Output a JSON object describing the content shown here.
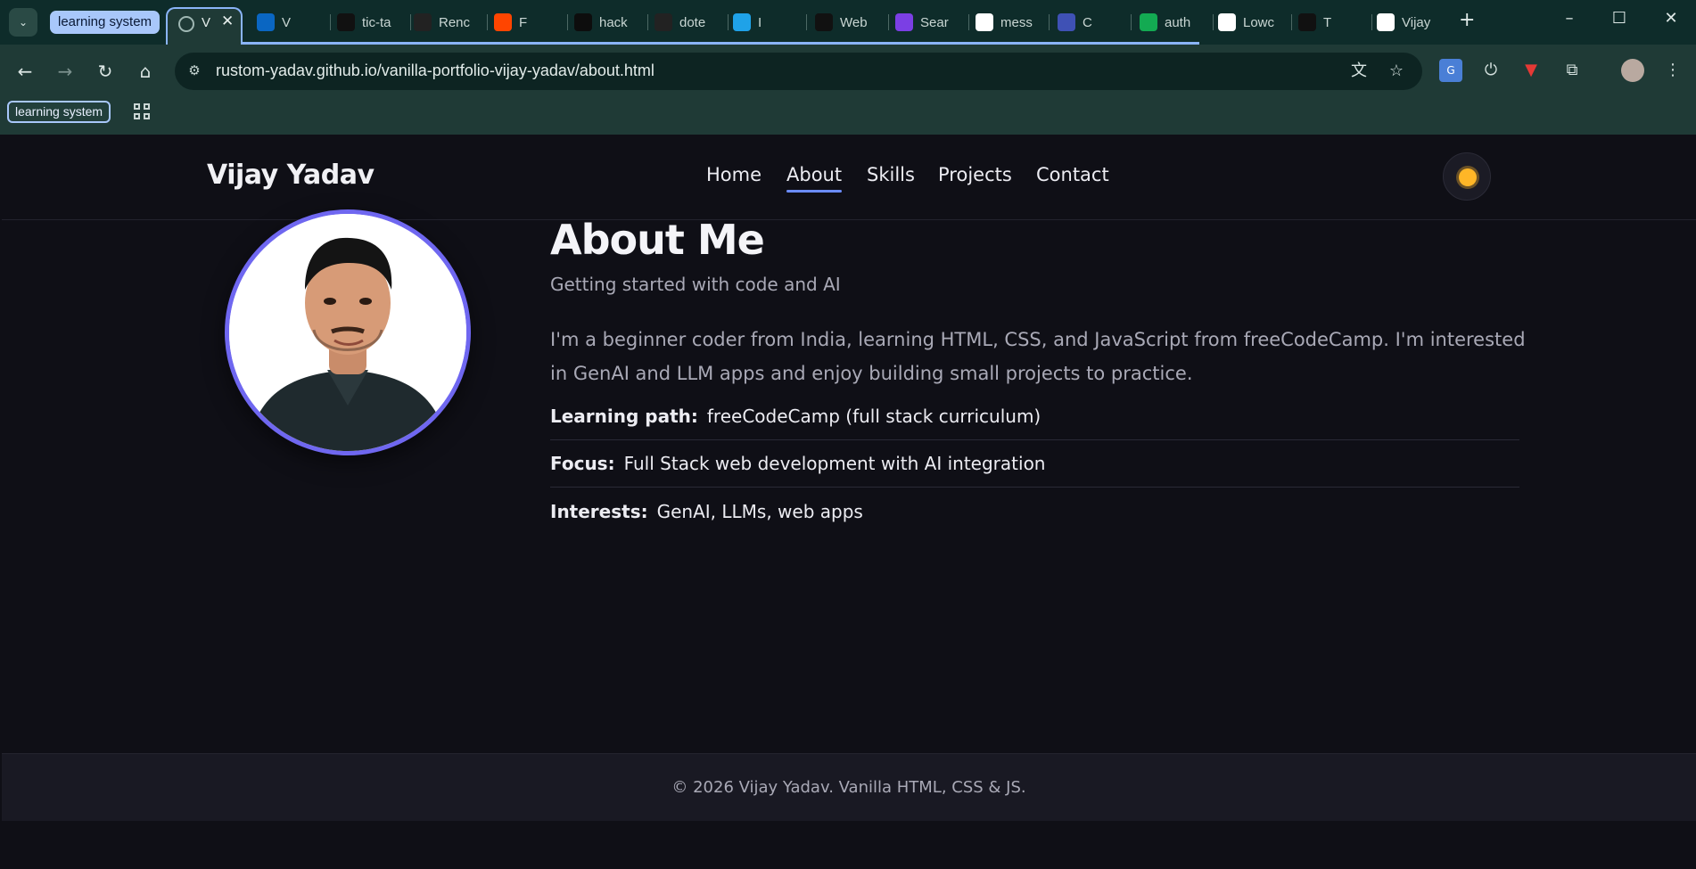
{
  "browser": {
    "tab_group_label": "learning system",
    "active_tab_title": "V",
    "tabs": [
      {
        "title": "V",
        "icon": "linkedin-icon",
        "color": "#0a66c2"
      },
      {
        "title": "tic-ta",
        "icon": "triangle-icon",
        "color": "#111111"
      },
      {
        "title": "Renc",
        "icon": "render-icon",
        "color": "#222222"
      },
      {
        "title": "F",
        "icon": "reddit-icon",
        "color": "#ff4500"
      },
      {
        "title": "hack",
        "icon": "hackernoon-icon",
        "color": "#0d0d0d"
      },
      {
        "title": "dote",
        "icon": "dotenv-icon",
        "color": "#222222"
      },
      {
        "title": "I",
        "icon": "is-icon",
        "color": "#1fa2e8"
      },
      {
        "title": "Web",
        "icon": "mk-icon",
        "color": "#111111"
      },
      {
        "title": "Sear",
        "icon": "search-app-icon",
        "color": "#7b3fe4"
      },
      {
        "title": "mess",
        "icon": "info-icon",
        "color": "#ffffff"
      },
      {
        "title": "C",
        "icon": "dashboard-icon",
        "color": "#3f51b5"
      },
      {
        "title": "auth",
        "icon": "mongodb-leaf-icon",
        "color": "#13aa52"
      },
      {
        "title": "Lowc",
        "icon": "openai-icon",
        "color": "#ffffff"
      },
      {
        "title": "T",
        "icon": "react-icon",
        "color": "#111111"
      },
      {
        "title": "Vijay",
        "icon": "r-icon",
        "color": "#ffffff"
      }
    ],
    "url": "rustom-yadav.github.io/vanilla-portfolio-vijay-yadav/about.html",
    "bookmark_chip": "learning system"
  },
  "site": {
    "brand": "Vijay Yadav",
    "nav": [
      "Home",
      "About",
      "Skills",
      "Projects",
      "Contact"
    ],
    "active_nav": "About",
    "accent": "#6b8cff",
    "avatar_ring_color": "#6f67f0"
  },
  "about": {
    "title": "About Me",
    "subtitle": "Getting started with code and AI",
    "bio": "I'm a beginner coder from India, learning HTML, CSS, and JavaScript from freeCodeCamp. I'm interested in GenAI and LLM apps and enjoy building small projects to practice.",
    "facts": [
      {
        "label": "Learning path:",
        "value": "freeCodeCamp (full stack curriculum)"
      },
      {
        "label": "Focus:",
        "value": "Full Stack web development with AI integration"
      },
      {
        "label": "Interests:",
        "value": "GenAI, LLMs, web apps"
      }
    ]
  },
  "footer": {
    "text": "© 2026 Vijay Yadav. Vanilla HTML, CSS & JS."
  }
}
